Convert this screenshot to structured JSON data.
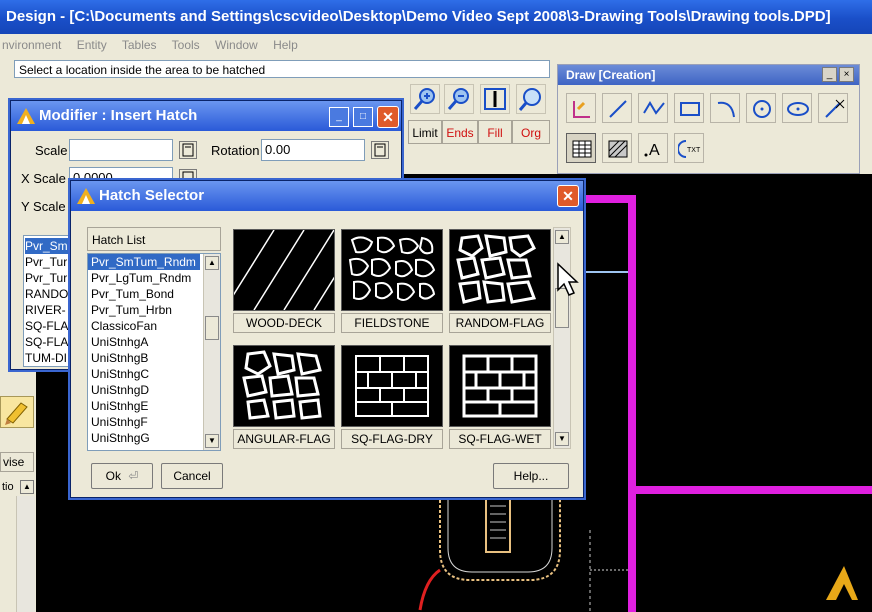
{
  "app": {
    "title": "Design  - [C:\\Documents and Settings\\cscvideo\\Desktop\\Demo Video Sept 2008\\3-Drawing Tools\\Drawing tools.DPD]",
    "menu": [
      "nvironment",
      "Entity",
      "Tables",
      "Tools",
      "Window",
      "Help"
    ],
    "prompt": "Select a location inside the area to be hatched"
  },
  "limit_row": [
    "Limit",
    "Ends",
    "Fill",
    "Org"
  ],
  "draw_palette": {
    "title": "Draw [Creation]",
    "min_label": "_",
    "close_label": "×"
  },
  "modifier": {
    "title": "Modifier : Insert Hatch",
    "scale_label": "Scale",
    "scale_value": "",
    "rotation_label": "Rotation",
    "rotation_value": "0.00",
    "xscale_label": "X Scale",
    "xscale_value": "0.0000",
    "yscale_label": "Y Scale",
    "list": [
      "Pvr_Sm",
      "Pvr_Tur",
      "Pvr_Tur",
      "RANDO",
      "RIVER-",
      "SQ-FLA",
      "SQ-FLA",
      "TUM-DI"
    ]
  },
  "hatch_selector": {
    "title": "Hatch Selector",
    "list_header": "Hatch List",
    "items": [
      "Pvr_SmTum_Rndm",
      "Pvr_LgTum_Rndm",
      "Pvr_Tum_Bond",
      "Pvr_Tum_Hrbn",
      "ClassicoFan",
      "UniStnhgA",
      "UniStnhgB",
      "UniStnhgC",
      "UniStnhgD",
      "UniStnhgE",
      "UniStnhgF",
      "UniStnhgG"
    ],
    "selected_index": 0,
    "tiles": [
      "WOOD-DECK",
      "FIELDSTONE",
      "RANDOM-FLAG",
      "ANGULAR-FLAG",
      "SQ-FLAG-DRY",
      "SQ-FLAG-WET"
    ],
    "ok_label": "Ok",
    "cancel_label": "Cancel",
    "help_label": "Help...",
    "close_label": "✕"
  },
  "left_panel": {
    "revise_label": "vise",
    "prop_label": "tio"
  },
  "colors": {
    "accent_title": "#2a5ad8",
    "magenta": "#e020e0",
    "selection": "#316ac5"
  }
}
